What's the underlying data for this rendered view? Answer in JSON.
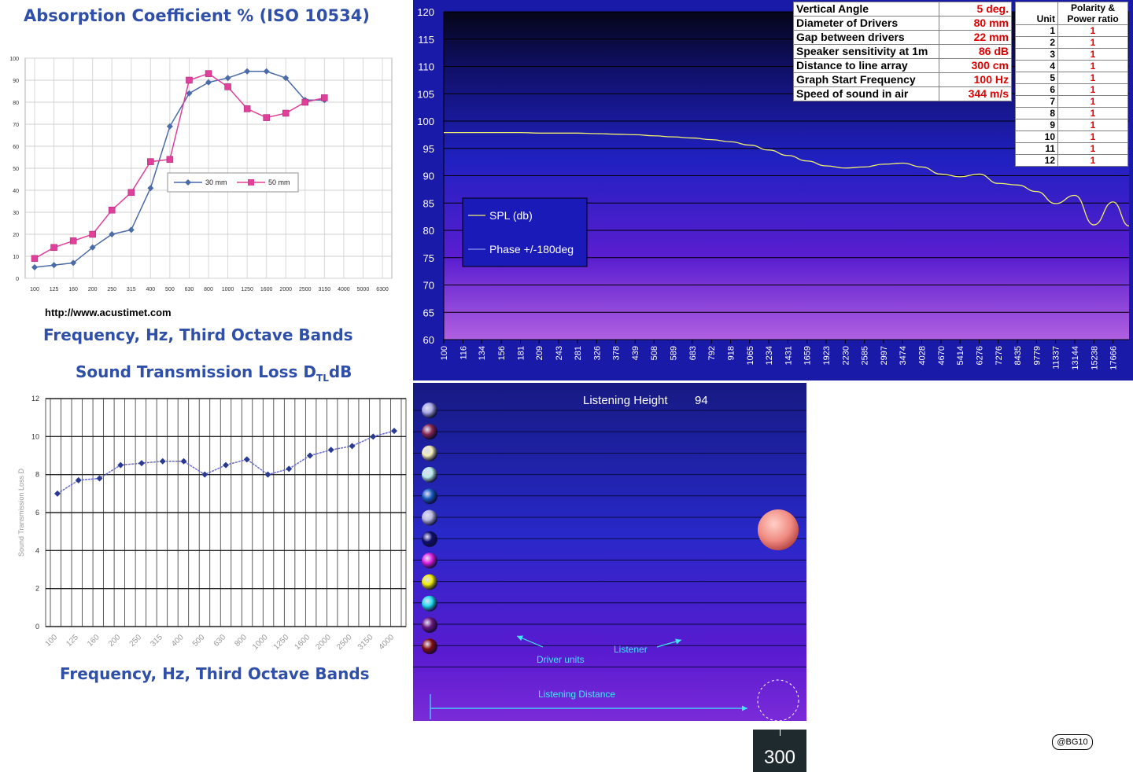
{
  "absorption": {
    "title": "Absorption Coefficient % (ISO 10534)",
    "url": "http://www.acustimet.com",
    "xlabel": "Frequency, Hz, Third Octave Bands",
    "legend": [
      "30 mm",
      "50 mm"
    ]
  },
  "transmission": {
    "title_main": "Sound Transmission Loss D",
    "title_sub": "TL",
    "title_unit": "dB",
    "ylabel": "Sound Transmission Loss D",
    "xlabel": "Frequency, Hz, Third Octave Bands"
  },
  "spl": {
    "legend": [
      "SPL (db)",
      "Phase +/-180deg"
    ],
    "params": [
      {
        "label": "Vertical Angle",
        "value": "5 deg."
      },
      {
        "label": "Diameter of Drivers",
        "value": "80 mm"
      },
      {
        "label": "Gap between drivers",
        "value": "22 mm"
      },
      {
        "label": "Speaker sensitivity at 1m",
        "value": "86 dB"
      },
      {
        "label": "Distance to line array",
        "value": "300 cm"
      },
      {
        "label": "Graph Start Frequency",
        "value": "100 Hz"
      },
      {
        "label": "Speed of sound in air",
        "value": "344 m/s"
      }
    ],
    "units_header": [
      "Unit",
      "Polarity &",
      "Power ratio"
    ],
    "units": [
      {
        "unit": "1",
        "ratio": "1"
      },
      {
        "unit": "2",
        "ratio": "1"
      },
      {
        "unit": "3",
        "ratio": "1"
      },
      {
        "unit": "4",
        "ratio": "1"
      },
      {
        "unit": "5",
        "ratio": "1"
      },
      {
        "unit": "6",
        "ratio": "1"
      },
      {
        "unit": "7",
        "ratio": "1"
      },
      {
        "unit": "8",
        "ratio": "1"
      },
      {
        "unit": "9",
        "ratio": "1"
      },
      {
        "unit": "10",
        "ratio": "1"
      },
      {
        "unit": "11",
        "ratio": "1"
      },
      {
        "unit": "12",
        "ratio": "1"
      }
    ]
  },
  "listening": {
    "height_label": "Listening Height",
    "height_value": "94",
    "driver_label": "Driver units",
    "listener_label": "Listener",
    "distance_label": "Listening Distance",
    "distance_value": "300",
    "driver_colors": [
      "#a8a8e8",
      "#8a2a55",
      "#f4eeb8",
      "#b8ecec",
      "#1a5cc0",
      "#b8b8e0",
      "#101070",
      "#e020e0",
      "#f0f000",
      "#20e0f0",
      "#6a1a80",
      "#801010"
    ],
    "listener_color": "#f08a80"
  },
  "credit": "@BG10",
  "chart_data": [
    {
      "type": "line",
      "title": "Absorption Coefficient % (ISO 10534)",
      "xlabel": "Frequency, Hz, Third Octave Bands",
      "ylabel": "",
      "categories": [
        "100",
        "125",
        "160",
        "200",
        "250",
        "315",
        "400",
        "500",
        "630",
        "800",
        "1000",
        "1250",
        "1600",
        "2000",
        "2500",
        "3150",
        "4000",
        "5000",
        "6300"
      ],
      "series": [
        {
          "name": "30 mm",
          "color": "#4a6aa8",
          "values": [
            5,
            6,
            7,
            14,
            20,
            22,
            41,
            69,
            84,
            89,
            91,
            94,
            94,
            91,
            81,
            81,
            null,
            null,
            null
          ]
        },
        {
          "name": "50 mm",
          "color": "#e0409a",
          "values": [
            9,
            14,
            17,
            20,
            31,
            39,
            53,
            54,
            90,
            93,
            87,
            77,
            73,
            75,
            80,
            82,
            null,
            null,
            null
          ]
        }
      ],
      "ylim": [
        0,
        100
      ],
      "yticks": [
        0,
        10,
        20,
        30,
        40,
        50,
        60,
        70,
        80,
        90,
        100
      ],
      "grid": true,
      "legend": "center-right"
    },
    {
      "type": "line",
      "title": "Sound Transmission Loss DTLdB",
      "xlabel": "Frequency, Hz, Third Octave Bands",
      "ylabel": "Sound Transmission Loss D",
      "categories": [
        "100",
        "125",
        "160",
        "200",
        "250",
        "315",
        "400",
        "500",
        "630",
        "800",
        "1000",
        "1250",
        "1600",
        "2000",
        "2500",
        "3150",
        "4000"
      ],
      "series": [
        {
          "color": "#2a3a90",
          "values": [
            7.0,
            7.7,
            7.8,
            8.5,
            8.6,
            8.7,
            8.7,
            8.0,
            8.5,
            8.8,
            8.0,
            8.3,
            9.0,
            9.3,
            9.5,
            10.0,
            10.3
          ]
        }
      ],
      "ylim": [
        0,
        12
      ],
      "yticks": [
        0,
        2,
        4,
        6,
        8,
        10,
        12
      ],
      "grid": true
    },
    {
      "type": "line",
      "title": "",
      "xlabel": "",
      "ylabel": "",
      "x_tick_labels": [
        "100",
        "116",
        "134",
        "156",
        "181",
        "209",
        "243",
        "281",
        "326",
        "378",
        "439",
        "508",
        "589",
        "683",
        "792",
        "918",
        "1065",
        "1234",
        "1431",
        "1659",
        "1923",
        "2230",
        "2585",
        "2997",
        "3474",
        "4028",
        "4670",
        "5414",
        "6276",
        "7276",
        "8435",
        "9779",
        "11337",
        "13144",
        "15238",
        "17666"
      ],
      "series": [
        {
          "name": "SPL (db)",
          "color": "#f0f070",
          "x": [
            100,
            116,
            134,
            156,
            181,
            209,
            243,
            281,
            326,
            378,
            439,
            508,
            589,
            683,
            792,
            918,
            1065,
            1234,
            1431,
            1659,
            1923,
            2230,
            2585,
            2997,
            3474,
            4028,
            4670,
            5414,
            6276,
            7276,
            8435,
            9779,
            11337,
            13144,
            15238,
            17666,
            20000
          ],
          "y": [
            97.9,
            97.9,
            97.9,
            97.9,
            97.9,
            97.8,
            97.8,
            97.8,
            97.7,
            97.6,
            97.5,
            97.3,
            97.1,
            96.9,
            96.6,
            96.2,
            95.6,
            94.7,
            93.7,
            92.7,
            91.8,
            91.4,
            91.6,
            92.1,
            92.3,
            91.6,
            90.3,
            89.8,
            90.3,
            88.6,
            88.3,
            87.1,
            84.9,
            86.4,
            81.0,
            85.2,
            80.8
          ]
        },
        {
          "name": "Phase +/-180deg",
          "color": "#b0b0ff",
          "x": [],
          "y": []
        }
      ],
      "ylim": [
        60,
        120
      ],
      "yticks": [
        60,
        65,
        70,
        75,
        80,
        85,
        90,
        95,
        100,
        105,
        110,
        115,
        120
      ],
      "grid": true,
      "legend": "left"
    }
  ]
}
